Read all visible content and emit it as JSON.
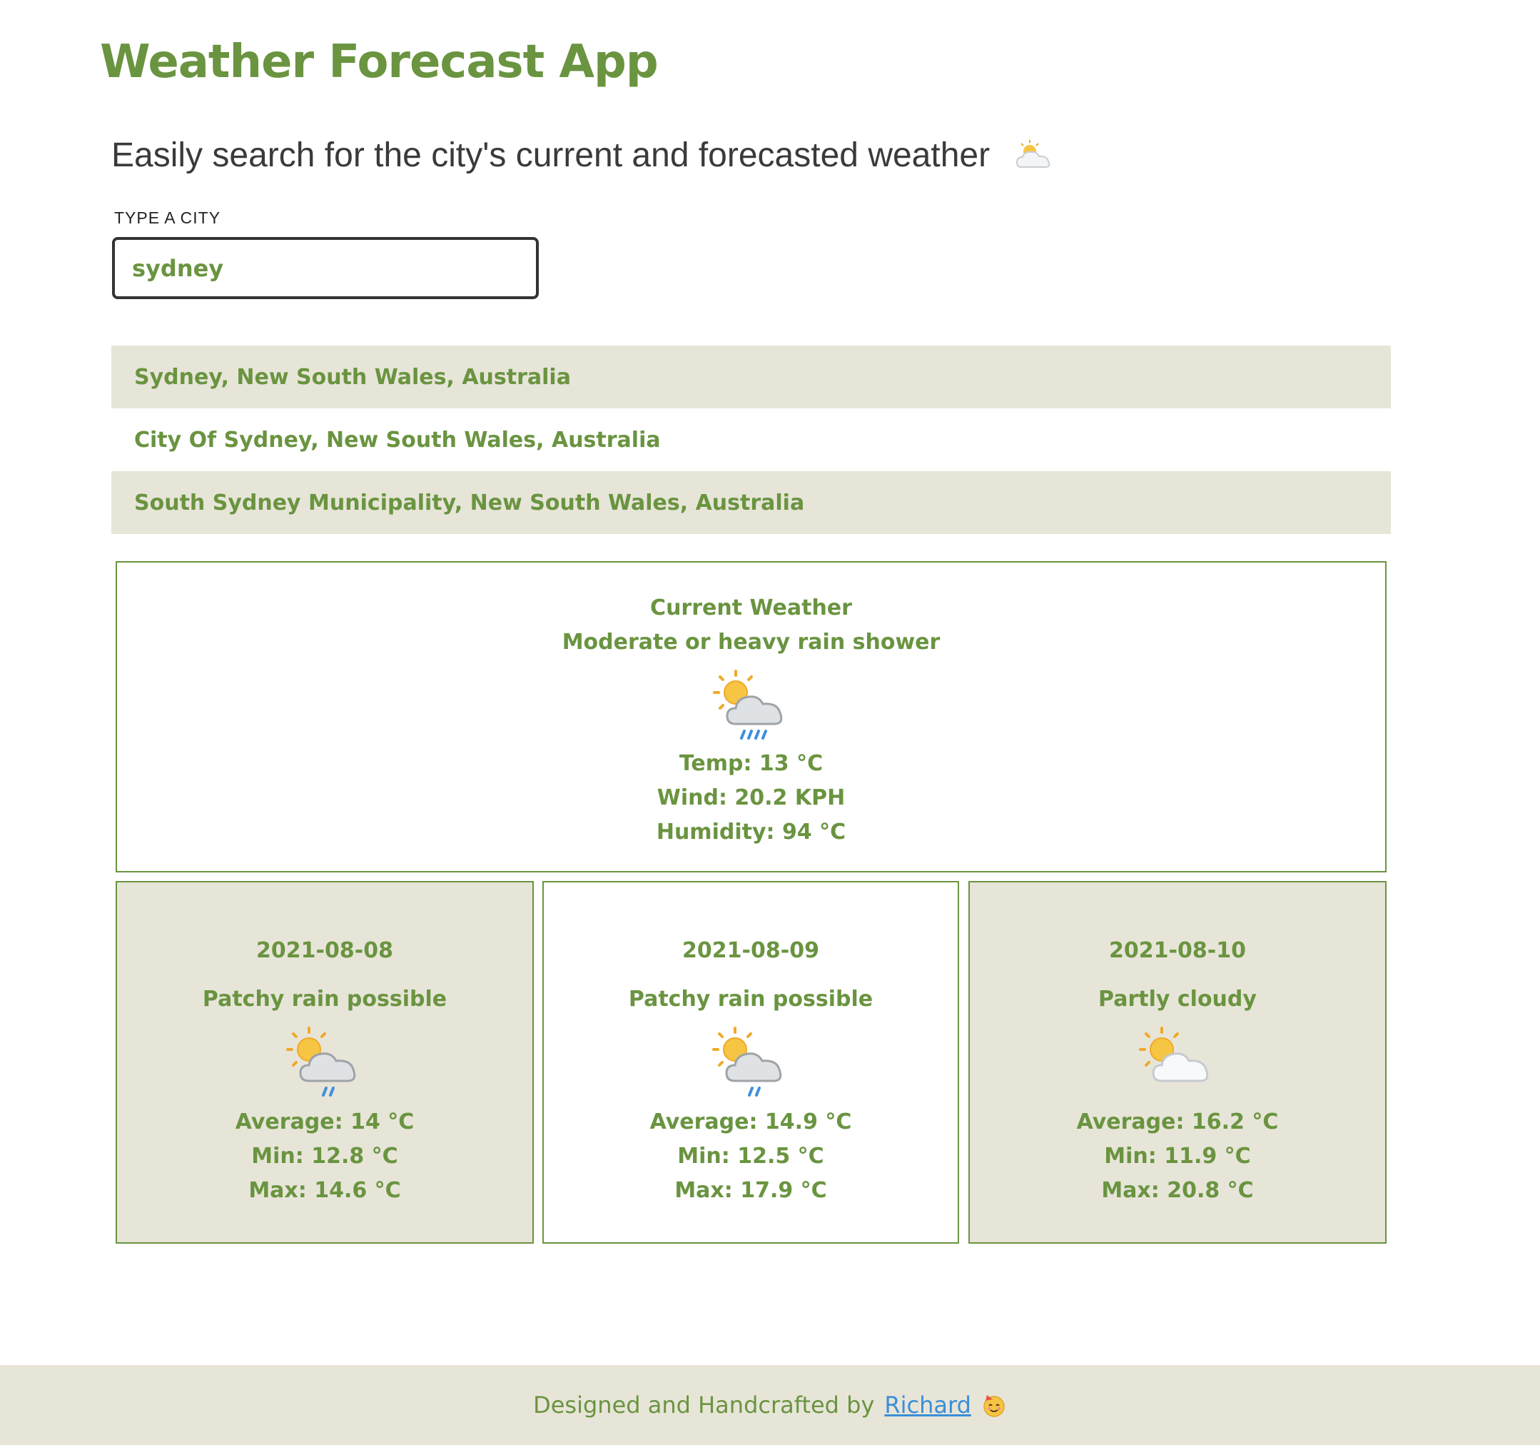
{
  "header": {
    "title": "Weather Forecast App",
    "subtitle": "Easily search for the city's current and forecasted weather"
  },
  "search": {
    "label": "TYPE A CITY",
    "value": "sydney"
  },
  "suggestions": [
    {
      "label": "Sydney, New South Wales, Australia"
    },
    {
      "label": "City Of Sydney, New South Wales, Australia"
    },
    {
      "label": "South Sydney Municipality, New South Wales, Australia"
    }
  ],
  "current": {
    "heading": "Current Weather",
    "condition": "Moderate or heavy rain shower",
    "icon": "sun-cloud-heavy-rain-icon",
    "temp": "Temp: 13 °C",
    "wind": "Wind: 20.2 KPH",
    "humidity": "Humidity: 94 °C"
  },
  "forecast": [
    {
      "date": "2021-08-08",
      "condition": "Patchy rain possible",
      "icon": "sun-cloud-light-rain-icon",
      "average": "Average: 14 °C",
      "min": "Min: 12.8 °C",
      "max": "Max: 14.6 °C"
    },
    {
      "date": "2021-08-09",
      "condition": "Patchy rain possible",
      "icon": "sun-cloud-light-rain-icon",
      "average": "Average: 14.9 °C",
      "min": "Min: 12.5 °C",
      "max": "Max: 17.9 °C"
    },
    {
      "date": "2021-08-10",
      "condition": "Partly cloudy",
      "icon": "sun-cloud-icon",
      "average": "Average: 16.2 °C",
      "min": "Min: 11.9 °C",
      "max": "Max: 20.8 °C"
    }
  ],
  "footer": {
    "text": "Designed and Handcrafted by",
    "link": "Richard",
    "emoji_icon": "party-face-icon"
  },
  "colors": {
    "accent": "#6a9440",
    "panel": "#e7e5d8",
    "link": "#3a8fd8"
  }
}
